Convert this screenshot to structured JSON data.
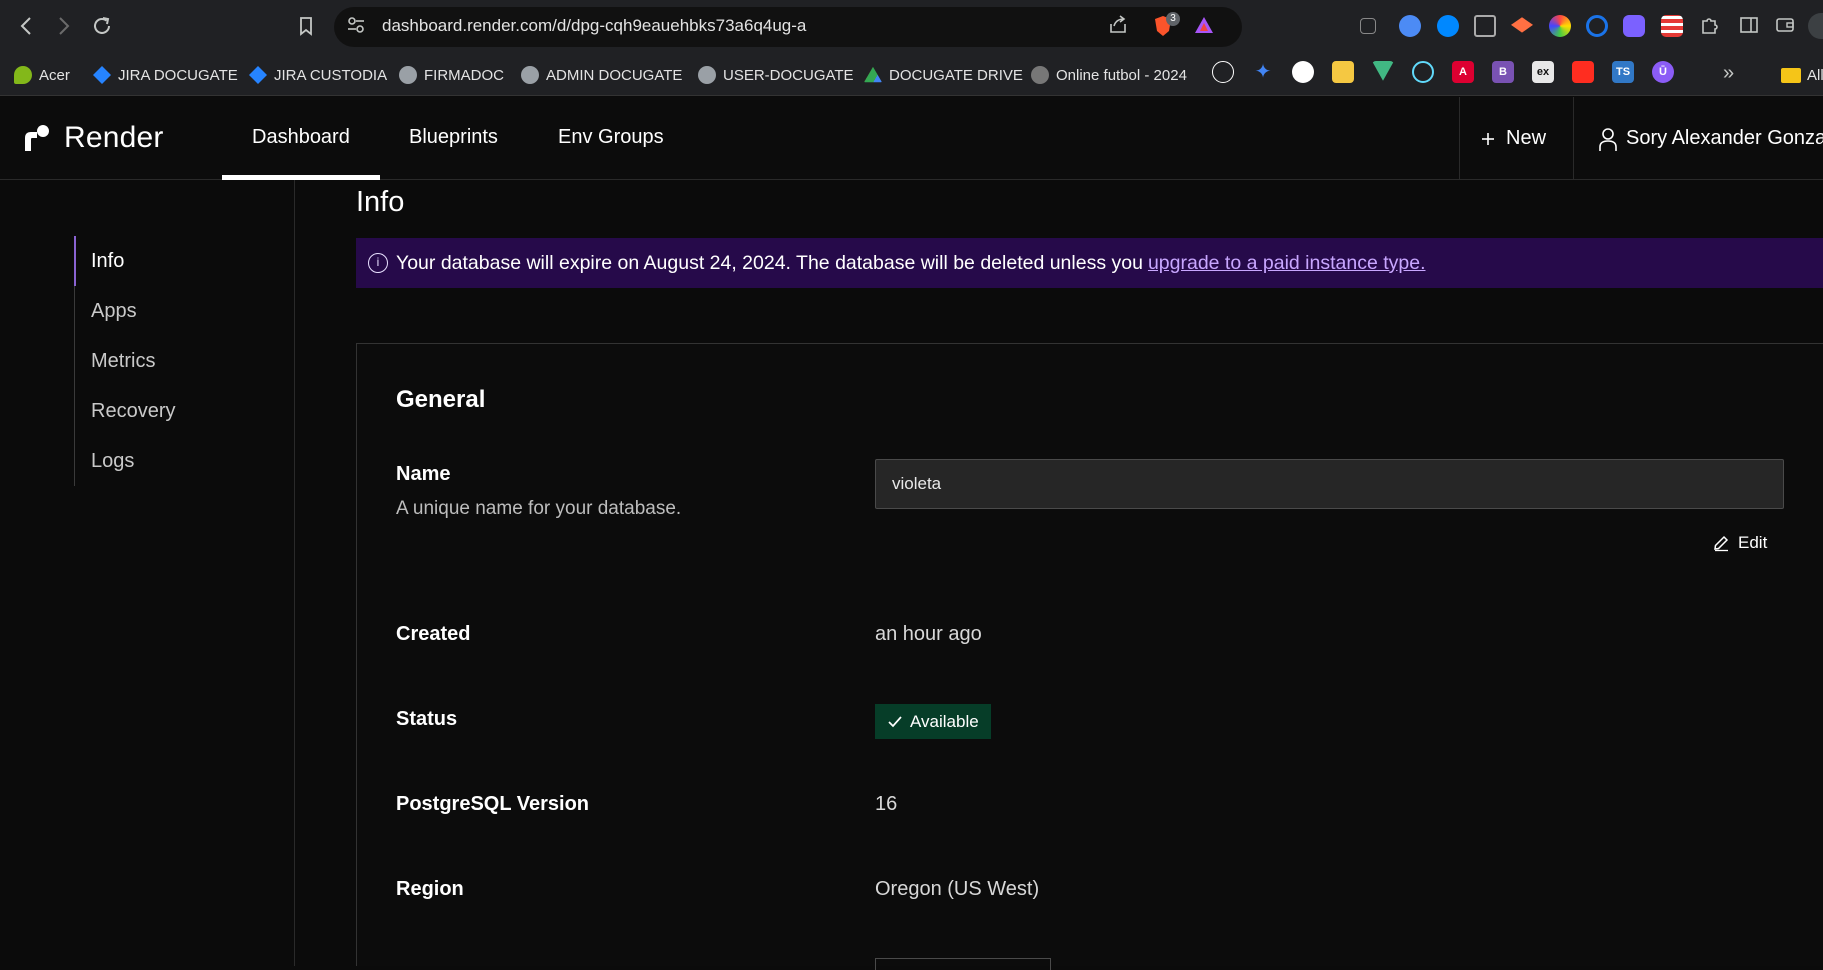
{
  "browser": {
    "url": "dashboard.render.com/d/dpg-cqh9eauehbks73a6q4ug-a",
    "brave_badge_count": "3"
  },
  "bookmarks": [
    {
      "label": "Acer",
      "color": "#83b81a"
    },
    {
      "label": "JIRA DOCUGATE",
      "color": "#2684ff"
    },
    {
      "label": "JIRA CUSTODIA",
      "color": "#2684ff"
    },
    {
      "label": "FIRMADOC",
      "color": "#9aa0a6"
    },
    {
      "label": "ADMIN DOCUGATE",
      "color": "#9aa0a6"
    },
    {
      "label": "USER-DOCUGATE",
      "color": "#9aa0a6"
    },
    {
      "label": "DOCUGATE DRIVE",
      "color": "#34a853"
    },
    {
      "label": "Online futbol - 2024",
      "color": "#777777"
    }
  ],
  "bookmark_icons": [
    {
      "name": "openai-icon",
      "glyph": "",
      "color": "#ffffff"
    },
    {
      "name": "gemini-icon",
      "glyph": "✦",
      "color": "#4285f4"
    },
    {
      "name": "github-icon",
      "glyph": "",
      "color": "#ffffff"
    },
    {
      "name": "emoji-icon",
      "glyph": "",
      "color": "#f5c842"
    },
    {
      "name": "vue-icon",
      "glyph": "",
      "color": "#41b883"
    },
    {
      "name": "react-icon",
      "glyph": "",
      "color": "#61dafb"
    },
    {
      "name": "angular-icon",
      "glyph": "A",
      "color": "#dd0031"
    },
    {
      "name": "bootstrap-icon",
      "glyph": "B",
      "color": "#7952b3"
    },
    {
      "name": "express-icon",
      "glyph": "ex",
      "color": "#3a3a3a"
    },
    {
      "name": "laravel-icon",
      "glyph": "",
      "color": "#ff2d20"
    },
    {
      "name": "typescript-icon",
      "glyph": "TS",
      "color": "#3178c6"
    },
    {
      "name": "u-icon",
      "glyph": "Ū",
      "color": "#8b5cf6"
    }
  ],
  "bookmarks_more": "»",
  "bookmarks_all": "All",
  "header": {
    "logo_text": "Render",
    "tabs": [
      "Dashboard",
      "Blueprints",
      "Env Groups"
    ],
    "new_label": "New",
    "user_name": "Sory Alexander Gonzalez"
  },
  "sidebar": {
    "items": [
      "Info",
      "Apps",
      "Metrics",
      "Recovery",
      "Logs"
    ]
  },
  "main": {
    "title": "Info",
    "banner_text": "Your database will expire on August 24, 2024. The database will be deleted unless you",
    "banner_link": "upgrade to a paid instance type.",
    "section_title": "General",
    "name_label": "Name",
    "name_desc": "A unique name for your database.",
    "name_value": "violeta",
    "edit_label": "Edit",
    "created_label": "Created",
    "created_value": "an hour ago",
    "status_label": "Status",
    "status_value": "Available",
    "pg_label": "PostgreSQL Version",
    "pg_value": "16",
    "region_label": "Region",
    "region_value": "Oregon (US West)"
  },
  "colors": {
    "accent": "#8a63d2",
    "banner_bg": "#260a4a",
    "status_bg": "#063d28",
    "link": "#c8a6ff"
  }
}
